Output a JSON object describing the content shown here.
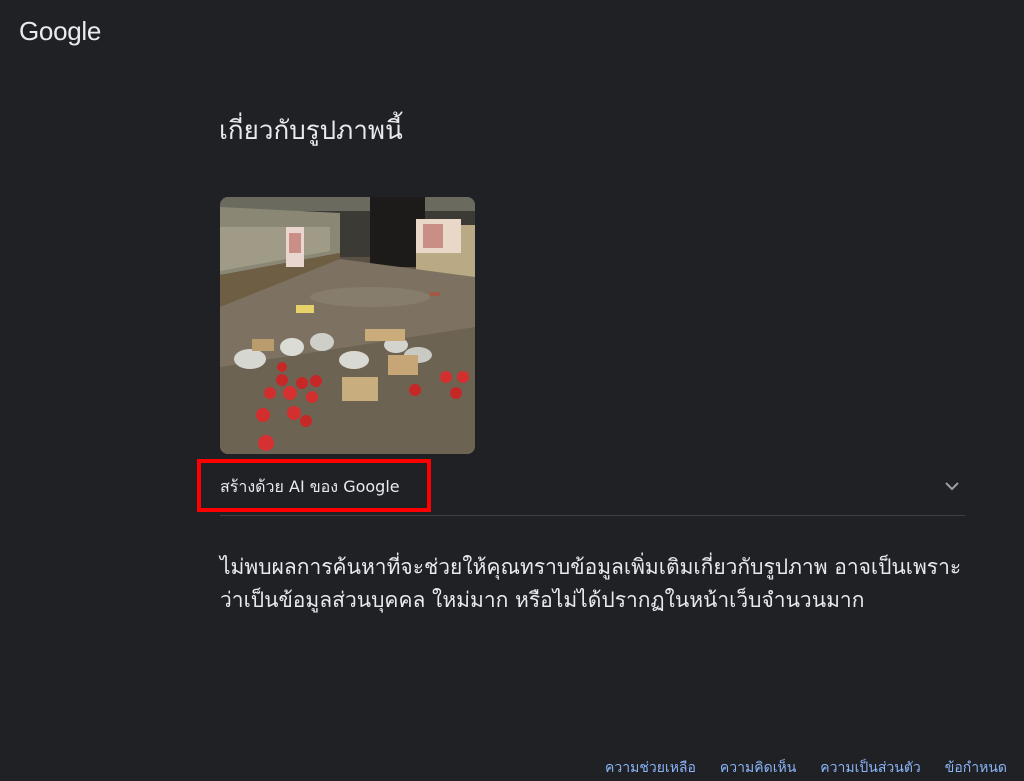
{
  "header": {
    "logo_text": "Google"
  },
  "main": {
    "title": "เกี่ยวกับรูปภาพนี้",
    "image_alt": "ร้านทองที่น้ำท่วม มีกล่องแหวนรูปหัวใจสีแดงกระจายบนพื้นโคลน",
    "ai_label": "สร้างด้วย AI ของ Google",
    "message": "ไม่พบผลการค้นหาที่จะช่วยให้คุณทราบข้อมูลเพิ่มเติมเกี่ยวกับรูปภาพ อาจเป็นเพราะว่าเป็นข้อมูลส่วนบุคคล ใหม่มาก หรือไม่ได้ปรากฏในหน้าเว็บจำนวนมาก"
  },
  "footer": {
    "links": [
      {
        "label": "ความช่วยเหลือ"
      },
      {
        "label": "ความคิดเห็น"
      },
      {
        "label": "ความเป็นส่วนตัว"
      },
      {
        "label": "ข้อกำหนด"
      }
    ]
  },
  "colors": {
    "background": "#202124",
    "text": "#e8eaed",
    "link": "#8ab4f8",
    "highlight_box": "#ff0000",
    "divider": "#3c4043"
  },
  "icons": {
    "expand": "chevron-down-icon"
  }
}
